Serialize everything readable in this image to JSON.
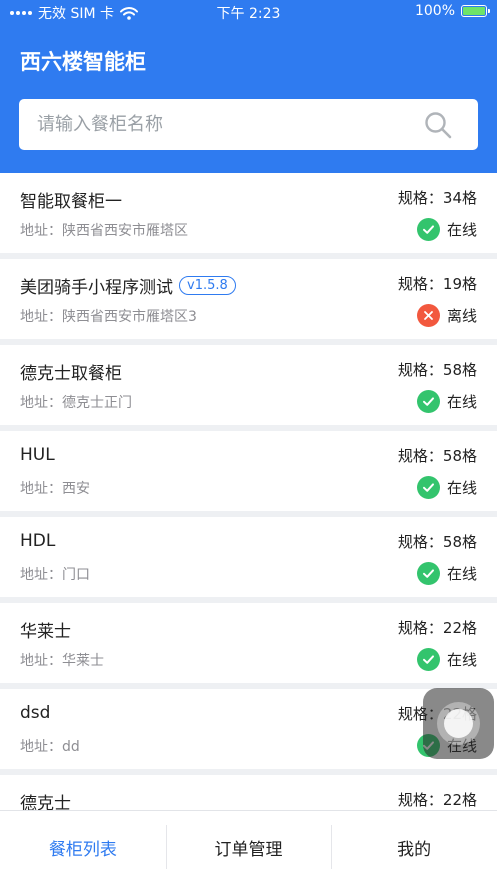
{
  "status_bar": {
    "carrier": "无效 SIM 卡",
    "time": "下午 2:23",
    "battery": "100%"
  },
  "header": {
    "title": "西六楼智能柜"
  },
  "search": {
    "placeholder": "请输入餐柜名称",
    "value": ""
  },
  "colors": {
    "primary": "#2f7bf0",
    "online": "#33c46d",
    "offline": "#f2583e"
  },
  "cabinets": [
    {
      "name": "智能取餐柜一",
      "version": "",
      "address": "地址：陕西省西安市雁塔区",
      "spec": "规格：34格",
      "status": "在线",
      "online": true
    },
    {
      "name": "美团骑手小程序测试",
      "version": "v1.5.8",
      "address": "地址：陕西省西安市雁塔区3",
      "spec": "规格：19格",
      "status": "离线",
      "online": false
    },
    {
      "name": "德克士取餐柜",
      "version": "",
      "address": "地址：德克士正门",
      "spec": "规格：58格",
      "status": "在线",
      "online": true
    },
    {
      "name": "HUL",
      "version": "",
      "address": "地址：西安",
      "spec": "规格：58格",
      "status": "在线",
      "online": true
    },
    {
      "name": "HDL",
      "version": "",
      "address": "地址：门口",
      "spec": "规格：58格",
      "status": "在线",
      "online": true
    },
    {
      "name": "华莱士",
      "version": "",
      "address": "地址：华莱士",
      "spec": "规格：22格",
      "status": "在线",
      "online": true
    },
    {
      "name": "dsd",
      "version": "",
      "address": "地址：dd",
      "spec": "规格：22格",
      "status": "在线",
      "online": true
    },
    {
      "name": "德克士",
      "version": "",
      "address": "",
      "spec": "规格：22格",
      "status": "",
      "online": true
    }
  ],
  "tabs": [
    {
      "label": "餐柜列表",
      "active": true
    },
    {
      "label": "订单管理",
      "active": false
    },
    {
      "label": "我的",
      "active": false
    }
  ]
}
